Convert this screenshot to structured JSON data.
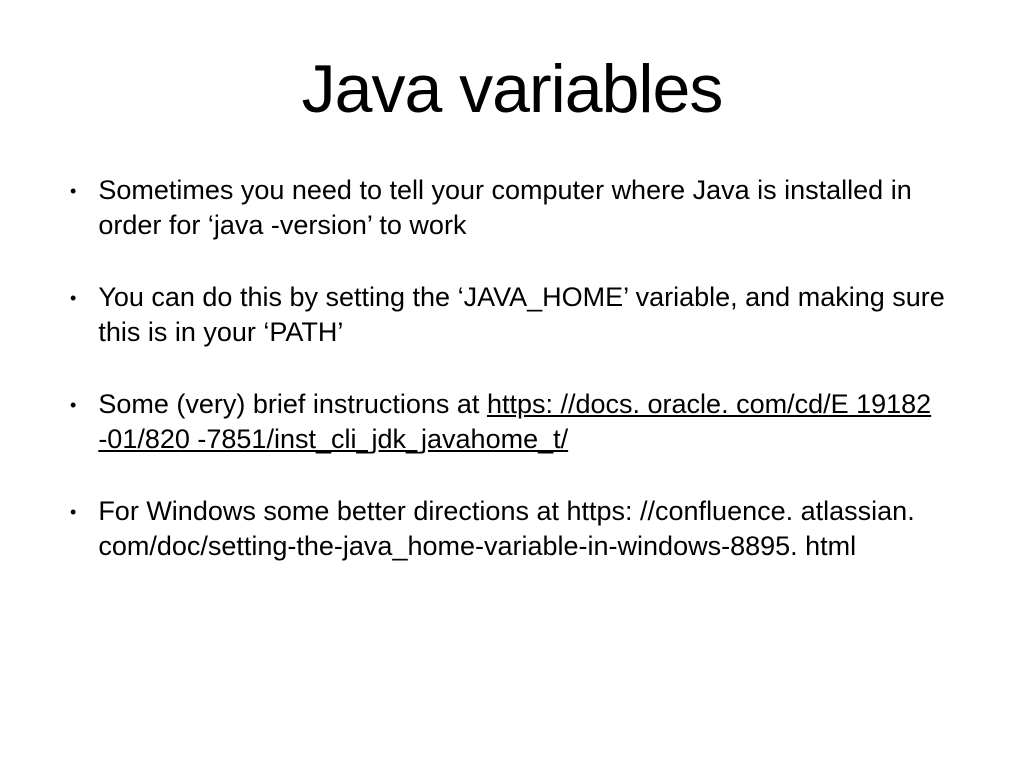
{
  "slide": {
    "title": "Java variables",
    "bullets": [
      {
        "text": "Sometimes you need to tell your computer where Java is installed in order for ‘java -version’ to work"
      },
      {
        "text": "You can do this by setting the ‘JAVA_HOME’ variable, and making sure this is in your ‘PATH’"
      },
      {
        "prefix": "Some (very) brief instructions at ",
        "link": "https: //docs. oracle. com/cd/E 19182 -01/820 -7851/inst_cli_jdk_javahome_t/"
      },
      {
        "text": "For Windows some better directions at https: //confluence. atlassian. com/doc/setting-the-java_home-variable-in-windows-8895. html"
      }
    ]
  }
}
